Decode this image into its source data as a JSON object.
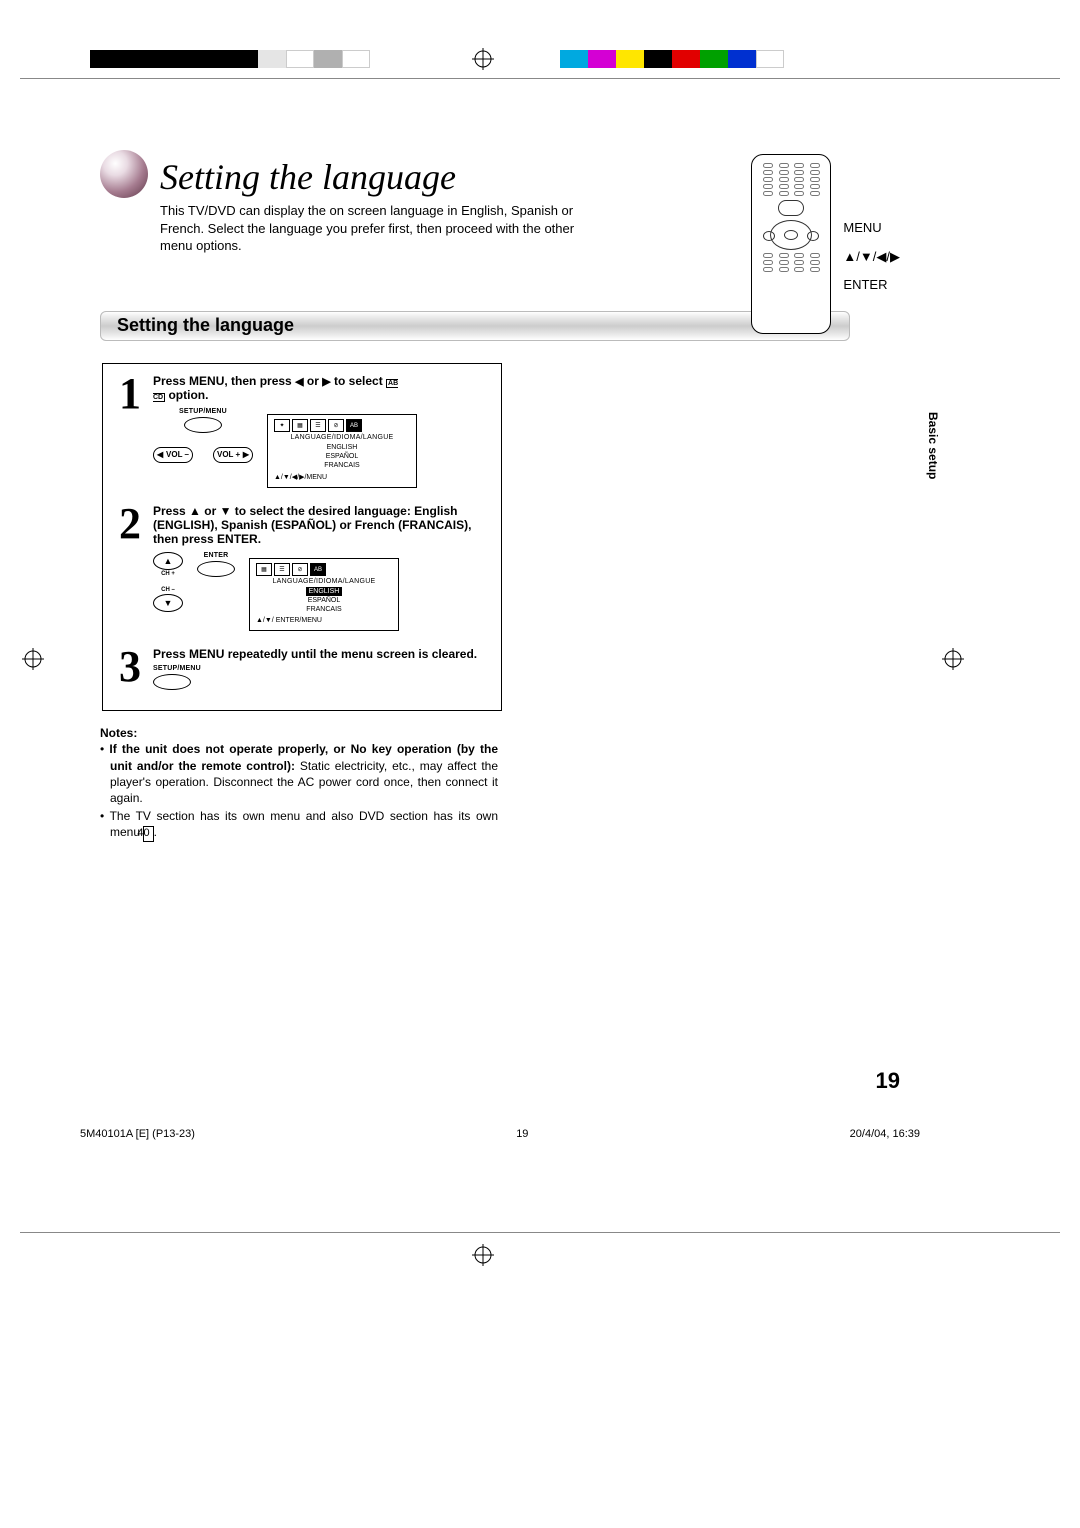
{
  "colorbar_left": [
    "#000000",
    "#000000",
    "#000000",
    "#000000",
    "#000000",
    "#000000",
    "#e5e5e5",
    "#ffffff",
    "#b0b0b0",
    "#ffffff"
  ],
  "colorbar_right": [
    "#00a9e0",
    "#d400d4",
    "#ffe600",
    "#000000",
    "#e10000",
    "#00a000",
    "#0030d0",
    "#ffffff"
  ],
  "title": "Setting the language",
  "intro": "This TV/DVD can display the on screen language in English, Spanish or French. Select the language you prefer first, then proceed with the other menu options.",
  "remote_labels": {
    "menu": "MENU",
    "arrows": "▲/▼/◀/▶",
    "enter": "ENTER"
  },
  "section_title": "Setting the language",
  "side_tab": "Basic setup",
  "steps": {
    "s1": {
      "num": "1",
      "text_a": "Press MENU, then press ",
      "text_b": " or ",
      "text_c": " to select ",
      "text_d": " option.",
      "btn_setup": "SETUP/MENU",
      "btn_vol_minus": "VOL –",
      "btn_vol_plus": "VOL +",
      "osd": {
        "heading": "LANGUAGE/IDIOMA/LANGUE",
        "opt1": "ENGLISH",
        "opt2": "ESPAÑOL",
        "opt3": "FRANCAIS",
        "footer": "▲/▼/◀/▶/MENU"
      }
    },
    "s2": {
      "num": "2",
      "text": "Press ▲ or ▼ to select the desired language: English (ENGLISH), Spanish (ESPAÑOL) or French (FRANCAIS), then press ENTER.",
      "ch_plus": "CH +",
      "ch_minus": "CH –",
      "enter": "ENTER",
      "osd": {
        "heading": "LANGUAGE/IDIOMA/LANGUE",
        "opt1": "ENGLISH",
        "opt2": "ESPAÑOL",
        "opt3": "FRANCAIS",
        "footer": "▲/▼/ ENTER/MENU"
      }
    },
    "s3": {
      "num": "3",
      "text": "Press MENU repeatedly until the menu screen is cleared.",
      "btn_setup": "SETUP/MENU"
    }
  },
  "notes": {
    "header": "Notes:",
    "n1a": "If the unit does not operate properly, or No key operation (by the unit and/or the remote control):",
    "n1b": " Static electricity, etc., may affect the player's operation. Disconnect the AC power cord once, then connect it again.",
    "n2a": "The TV section has its own menu and also DVD section has its own menu ",
    "n2b": "40",
    "n2c": "."
  },
  "page_number": "19",
  "footer": {
    "left": "5M40101A [E] (P13-23)",
    "mid": "19",
    "right": "20/4/04, 16:39"
  }
}
